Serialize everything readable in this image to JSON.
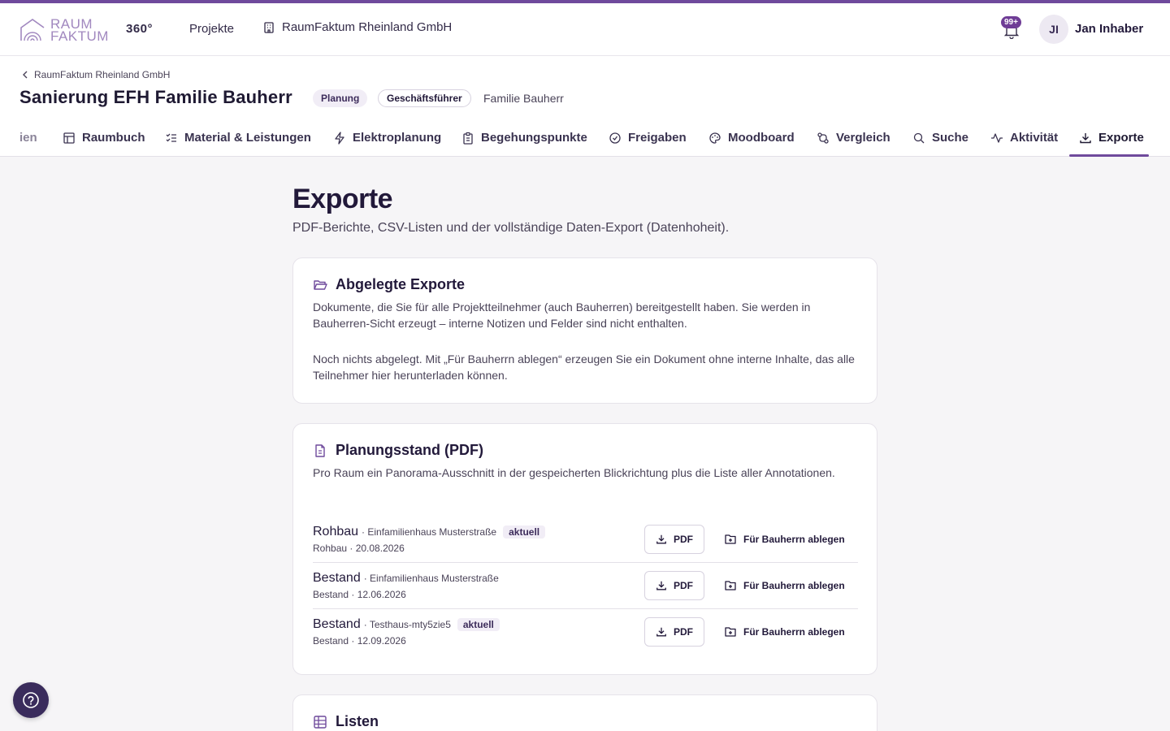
{
  "colors": {
    "accent": "#6f4a9c",
    "text": "#22193a",
    "muted": "#4a4358",
    "help": "#3a2c5c"
  },
  "header": {
    "logo_line1": "RAUM",
    "logo_line2": "FAKTUM",
    "brand_suffix": "360°",
    "nav_projects": "Projekte",
    "nav_company": "RaumFaktum Rheinland GmbH",
    "notification_count": "99+",
    "user_initials": "JI",
    "user_name": "Jan Inhaber"
  },
  "subheader": {
    "breadcrumb": "RaumFaktum Rheinland GmbH",
    "title": "Sanierung EFH Familie Bauherr",
    "status_pill": "Planung",
    "role_pill": "Geschäftsführer",
    "client": "Familie Bauherr"
  },
  "tabs": [
    {
      "label": "ien",
      "icon": "cut-off"
    },
    {
      "label": "Raumbuch",
      "icon": "table-icon"
    },
    {
      "label": "Material & Leistungen",
      "icon": "checklist-icon"
    },
    {
      "label": "Elektroplanung",
      "icon": "lightning-icon"
    },
    {
      "label": "Begehungspunkte",
      "icon": "clipboard-icon"
    },
    {
      "label": "Freigaben",
      "icon": "check-circle-icon"
    },
    {
      "label": "Moodboard",
      "icon": "palette-icon"
    },
    {
      "label": "Vergleich",
      "icon": "compare-icon"
    },
    {
      "label": "Suche",
      "icon": "search-icon"
    },
    {
      "label": "Aktivität",
      "icon": "activity-icon"
    },
    {
      "label": "Exporte",
      "icon": "download-icon",
      "active": true
    }
  ],
  "page": {
    "title": "Exporte",
    "subtitle": "PDF-Berichte, CSV-Listen und der vollständige Daten-Export (Datenhoheit)."
  },
  "card_archived": {
    "title": "Abgelegte Exporte",
    "text1": "Dokumente, die Sie für alle Projektteilnehmer (auch Bauherren) bereitgestellt haben. Sie werden in Bauherren-Sicht erzeugt – interne Notizen und Felder sind nicht enthalten.",
    "text2": "Noch nichts abgelegt. Mit „Für Bauherrn ablegen“ erzeugen Sie ein Dokument ohne interne Inhalte, das alle Teilnehmer hier herunterladen können."
  },
  "card_planning": {
    "title": "Planungsstand (PDF)",
    "text": "Pro Raum ein Panorama-Ausschnitt in der gespeicherten Blickrichtung plus die Liste aller Annotationen.",
    "pdf_label": "PDF",
    "ablegen_label": "Für Bauherrn ablegen",
    "rows": [
      {
        "name": "Rohbau",
        "meta": "· Einfamilienhaus Musterstraße",
        "tag": "aktuell",
        "date": "Rohbau · 20.08.2026"
      },
      {
        "name": "Bestand",
        "meta": "· Einfamilienhaus Musterstraße",
        "tag": "",
        "date": "Bestand · 12.06.2026"
      },
      {
        "name": "Bestand",
        "meta": "· Testhaus-mty5zie5",
        "tag": "aktuell",
        "date": "Bestand · 12.09.2026"
      }
    ]
  },
  "card_lists": {
    "title": "Listen"
  }
}
